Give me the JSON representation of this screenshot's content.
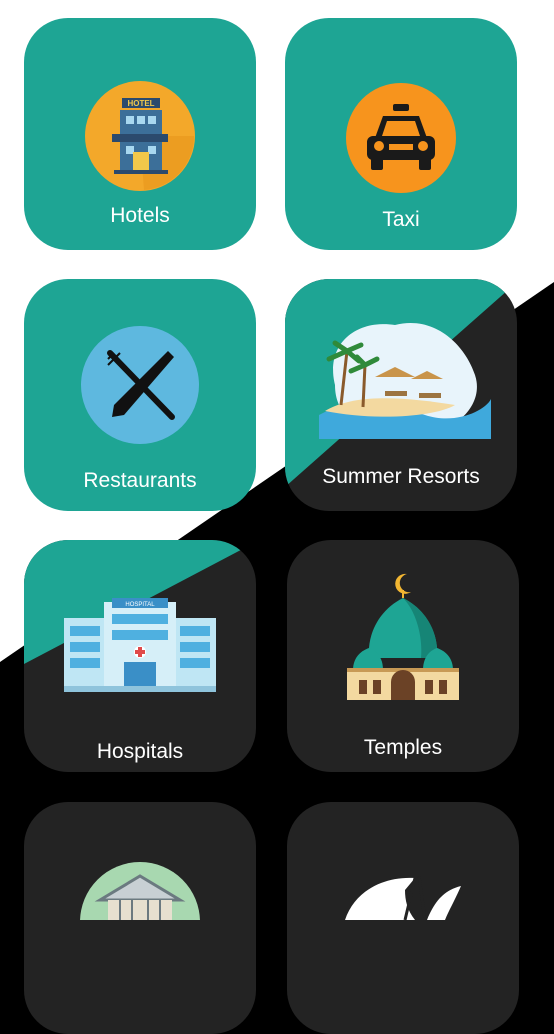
{
  "categories": [
    {
      "label": "Hotels",
      "icon": "hotel-icon"
    },
    {
      "label": "Taxi",
      "icon": "taxi-icon"
    },
    {
      "label": "Restaurants",
      "icon": "restaurant-icon"
    },
    {
      "label": "Summer Resorts",
      "icon": "beach-resort-icon"
    },
    {
      "label": "Hospitals",
      "icon": "hospital-icon"
    },
    {
      "label": "Temples",
      "icon": "temple-icon"
    },
    {
      "label": "",
      "icon": "building-icon"
    },
    {
      "label": "",
      "icon": "leaf-icon"
    }
  ],
  "hotel_sign": "HOTEL",
  "hospital_sign": "HOSPITAL",
  "colors": {
    "tile_teal": "#1ea594",
    "tile_dark": "#232323",
    "background_light": "#ffffff",
    "background_dark": "#000000"
  }
}
